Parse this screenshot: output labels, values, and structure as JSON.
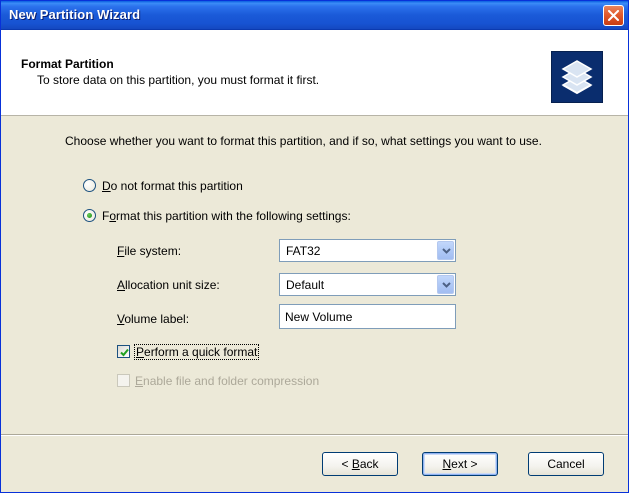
{
  "window": {
    "title": "New Partition Wizard"
  },
  "header": {
    "title": "Format Partition",
    "subtitle": "To store data on this partition, you must format it first.",
    "icon": "disk-stack-icon"
  },
  "intro": "Choose whether you want to format this partition, and if so, what settings you want to use.",
  "options": {
    "no_format": {
      "label_prefix": "",
      "accel": "D",
      "label_rest": "o not format this partition",
      "selected": false
    },
    "format": {
      "label_prefix": "F",
      "accel": "o",
      "label_rest": "rmat this partition with the following settings:",
      "selected": true
    }
  },
  "fields": {
    "file_system": {
      "accel": "F",
      "label_rest": "ile system:",
      "value": "FAT32"
    },
    "allocation": {
      "accel": "A",
      "label_rest": "llocation unit size:",
      "value": "Default"
    },
    "volume_label": {
      "accel": "V",
      "label_rest": "olume label:",
      "value": "New Volume"
    }
  },
  "checkboxes": {
    "quick_format": {
      "accel": "P",
      "label_rest": "erform a quick format",
      "checked": true,
      "enabled": true
    },
    "compression": {
      "accel": "E",
      "label_rest": "nable file and folder compression",
      "checked": false,
      "enabled": false
    }
  },
  "buttons": {
    "back": {
      "prefix": "< ",
      "accel": "B",
      "rest": "ack"
    },
    "next": {
      "accel": "N",
      "rest": "ext >"
    },
    "cancel": {
      "label": "Cancel"
    }
  },
  "colors": {
    "titlebar": "#1753d2",
    "face": "#ece9d8",
    "radio_dot": "#2d9d25"
  }
}
